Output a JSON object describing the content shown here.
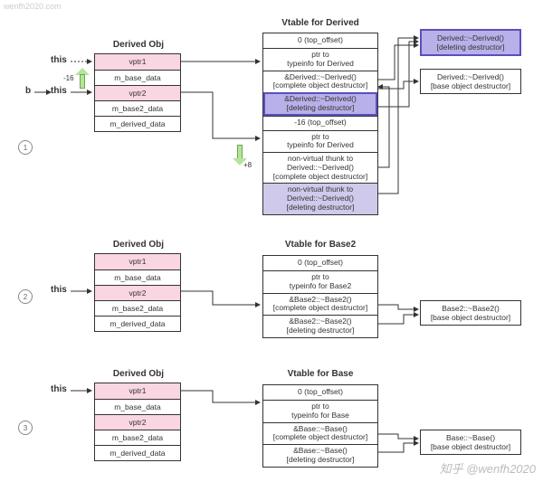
{
  "watermarks": {
    "top_left": "wenfh2020.com",
    "bottom_right": "知乎 @wenfh2020"
  },
  "badges": {
    "one": "1",
    "two": "2",
    "three": "3"
  },
  "pointers": {
    "this": "this",
    "b": "b"
  },
  "offsets": {
    "neg16": "-16",
    "plus8": "+8"
  },
  "section1": {
    "obj_title": "Derived Obj",
    "vtable_title": "Vtable for Derived",
    "obj_rows": {
      "vptr1": "vptr1",
      "m_base_data": "m_base_data",
      "vptr2": "vptr2",
      "m_base2_data": "m_base2_data",
      "m_derived_data": "m_derived_data"
    },
    "vtable_rows": {
      "r0": "0 (top_offset)",
      "r1": "ptr to\ntypeinfo for Derived",
      "r2": "&Derived::~Derived()\n[complete object destructor]",
      "r3": "&Derived::~Derived()\n[deleting destructor]",
      "r4": "-16 (top_offset)",
      "r5": "ptr to\ntypeinfo for Derived",
      "r6": "non-virtual thunk to\nDerived::~Derived()\n[complete object destructor]",
      "r7": "non-virtual thunk to\nDerived::~Derived()\n[deleting destructor]"
    },
    "fn": {
      "del": "Derived::~Derived()\n[deleting destructor]",
      "base": "Derived::~Derived()\n[base object destructor]"
    }
  },
  "section2": {
    "obj_title": "Derived Obj",
    "vtable_title": "Vtable for Base2",
    "obj_rows": {
      "vptr1": "vptr1",
      "m_base_data": "m_base_data",
      "vptr2": "vptr2",
      "m_base2_data": "m_base2_data",
      "m_derived_data": "m_derived_data"
    },
    "vtable_rows": {
      "r0": "0 (top_offset)",
      "r1": "ptr to\ntypeinfo for Base2",
      "r2": "&Base2::~Base2()\n[complete object destructor]",
      "r3": "&Base2::~Base2()\n[deleting destructor]"
    },
    "fn": {
      "base": "Base2::~Base2()\n[base object destructor]"
    }
  },
  "section3": {
    "obj_title": "Derived Obj",
    "vtable_title": "Vtable for Base",
    "obj_rows": {
      "vptr1": "vptr1",
      "m_base_data": "m_base_data",
      "vptr2": "vptr2",
      "m_base2_data": "m_base2_data",
      "m_derived_data": "m_derived_data"
    },
    "vtable_rows": {
      "r0": "0 (top_offset)",
      "r1": "ptr to\ntypeinfo for Base",
      "r2": "&Base::~Base()\n[complete object destructor]",
      "r3": "&Base::~Base()\n[deleting destructor]"
    },
    "fn": {
      "base": "Base::~Base()\n[base object destructor]"
    }
  }
}
